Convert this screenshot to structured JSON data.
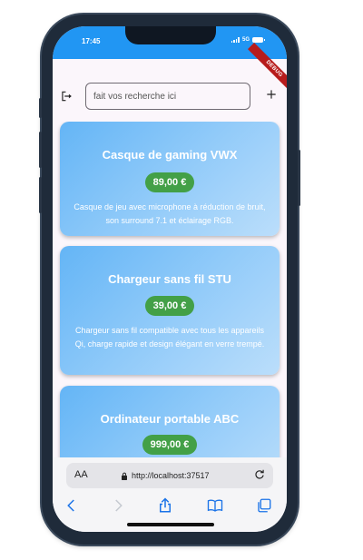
{
  "status": {
    "time": "17:45",
    "network": "5G"
  },
  "debug_banner": "DEBUG",
  "header": {
    "search_placeholder": "fait vos recherche ici"
  },
  "products": [
    {
      "name": "Casque de gaming VWX",
      "price": "89,00 €",
      "description": "Casque de jeu avec microphone à réduction de bruit, son surround 7.1 et éclairage RGB."
    },
    {
      "name": "Chargeur sans fil STU",
      "price": "39,00 €",
      "description": "Chargeur sans fil compatible avec tous les appareils Qi, charge rapide et design élégant en verre trempé."
    },
    {
      "name": "Ordinateur portable ABC",
      "price": "999,00 €",
      "description": ""
    }
  ],
  "browser": {
    "aa_label": "AA",
    "url": "http://localhost:37517"
  },
  "colors": {
    "app_bar": "#2196f3",
    "price_badge": "#43a047",
    "card_gradient_start": "#64b5f6",
    "card_gradient_end": "#bbdefb",
    "debug_banner": "#b71c1c",
    "safari_accent": "#1a73e8"
  },
  "icons": [
    "logout-icon",
    "add-icon",
    "lock-icon",
    "reload-icon",
    "back-icon",
    "forward-icon",
    "share-icon",
    "bookmarks-icon",
    "tabs-icon"
  ]
}
